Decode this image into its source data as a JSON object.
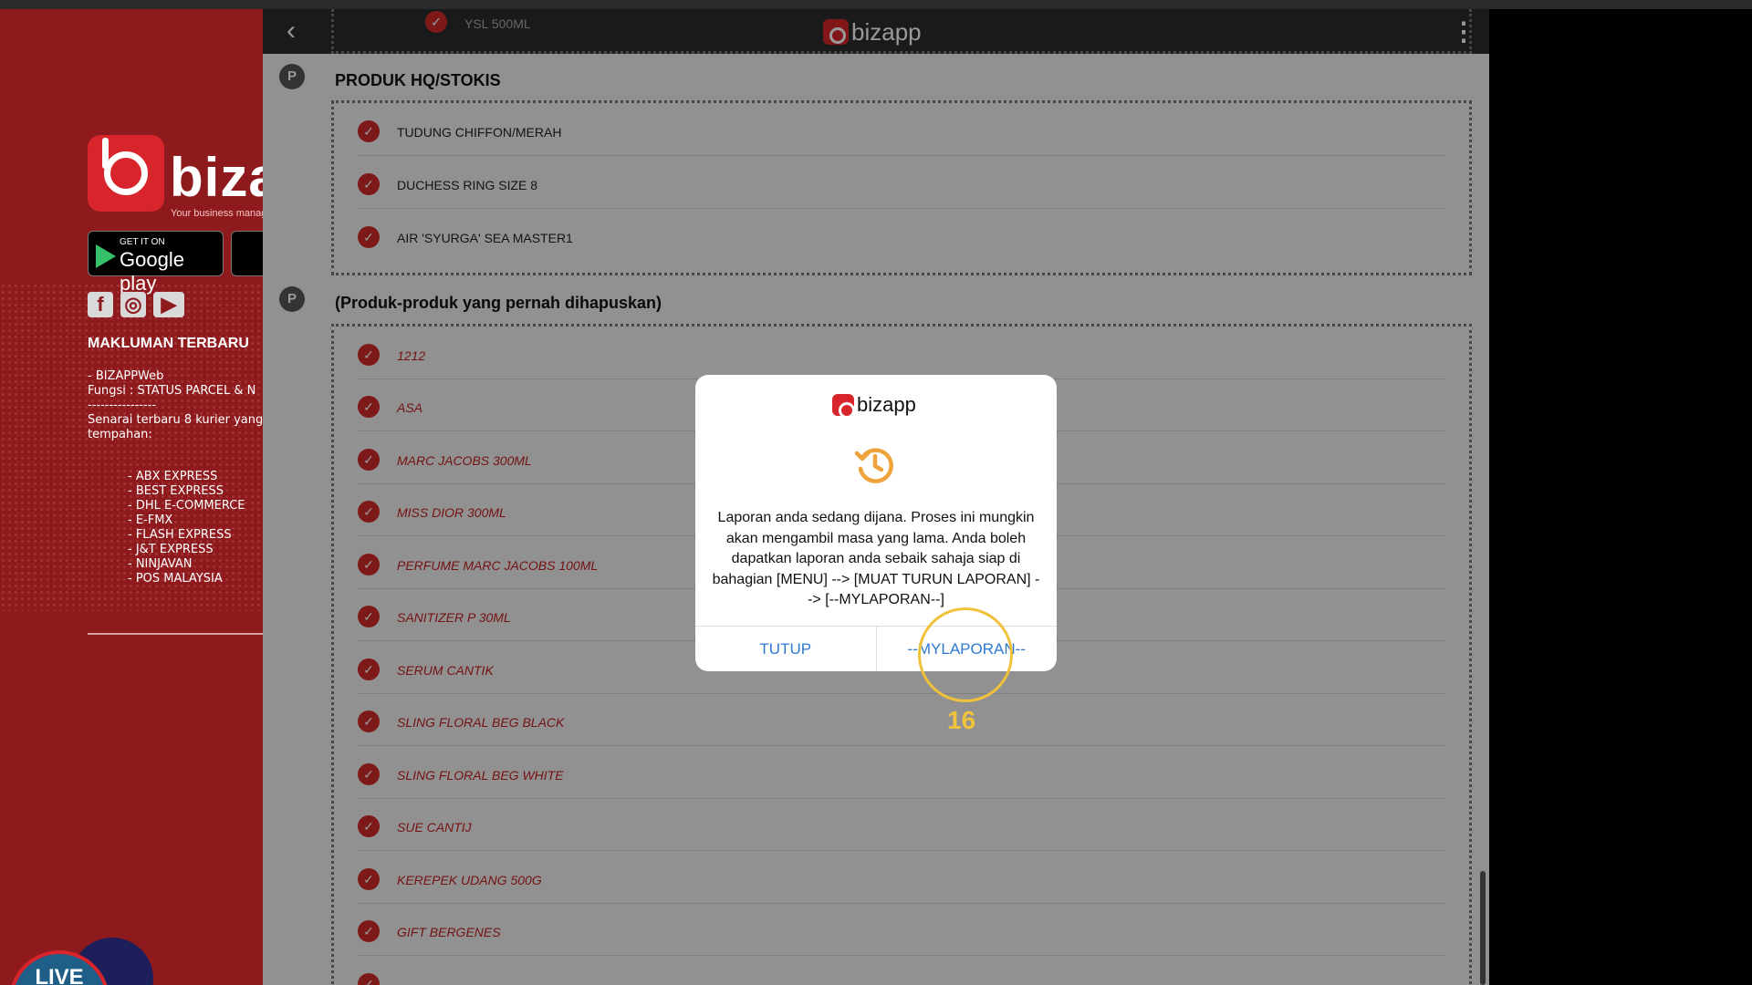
{
  "sidebar": {
    "brand_text": "bizapp",
    "tagline": "Your business management",
    "google_play_small": "GET IT ON",
    "google_play_big": "Google play",
    "social": [
      "f",
      "◎",
      "▶"
    ],
    "title": "MAKLUMAN TERBARU",
    "announcement": "- BIZAPPWeb\nFungsi : STATUS PARCEL & N\n----------------\nSenarai terbaru 8 kurier yang\ntempahan:",
    "couriers": [
      "- ABX EXPRESS",
      "- BEST EXPRESS",
      "- DHL E-COMMERCE",
      "- E-FMX",
      "- FLASH EXPRESS",
      "- J&T EXPRESS",
      "- NINJAVAN",
      "- POS MALAYSIA"
    ],
    "live_label": "LIVE"
  },
  "header": {
    "back_icon": "chevron-left-icon",
    "logo_text": "bizapp",
    "menu_icon": "kebab-menu-icon",
    "peek_item": "YSL 500ML"
  },
  "sections": [
    {
      "badge": "P",
      "title": "PRODUK HQ/STOKIS",
      "items": [
        "TUDUNG CHIFFON/MERAH",
        "DUCHESS RING SIZE 8",
        "AIR 'SYURGA' SEA MASTER1"
      ]
    },
    {
      "badge": "P",
      "title": "(Produk-produk yang pernah dihapuskan)",
      "items": [
        "1212",
        "ASA",
        "MARC JACOBS 300ML",
        "MISS DIOR 300ML",
        "PERFUME MARC JACOBS 100ML",
        "SANITIZER P 30ML",
        "SERUM CANTIK",
        "SLING FLORAL BEG BLACK",
        "SLING FLORAL BEG WHITE",
        "SUE CANTIJ",
        "KEREPEK UDANG 500G",
        "GIFT BERGENES"
      ]
    }
  ],
  "dialog": {
    "logo_text": "bizapp",
    "icon": "history-icon",
    "message": "Laporan anda sedang dijana. Proses ini mungkin akan mengambil masa yang lama. Anda boleh dapatkan laporan anda sebaik sahaja siap di bahagian [MENU] --> [MUAT TURUN LAPORAN] --> [--MYLAPORAN--]",
    "button_close": "TUTUP",
    "button_report": "--MYLAPORAN--"
  },
  "click_indicator": {
    "step": "16"
  },
  "colors": {
    "brand_red": "#d8252b",
    "sidebar_red": "#8e1a1d",
    "link_blue": "#2d7ad1",
    "accent_orange": "#eea33b",
    "indicator_yellow": "#f0c23b"
  }
}
